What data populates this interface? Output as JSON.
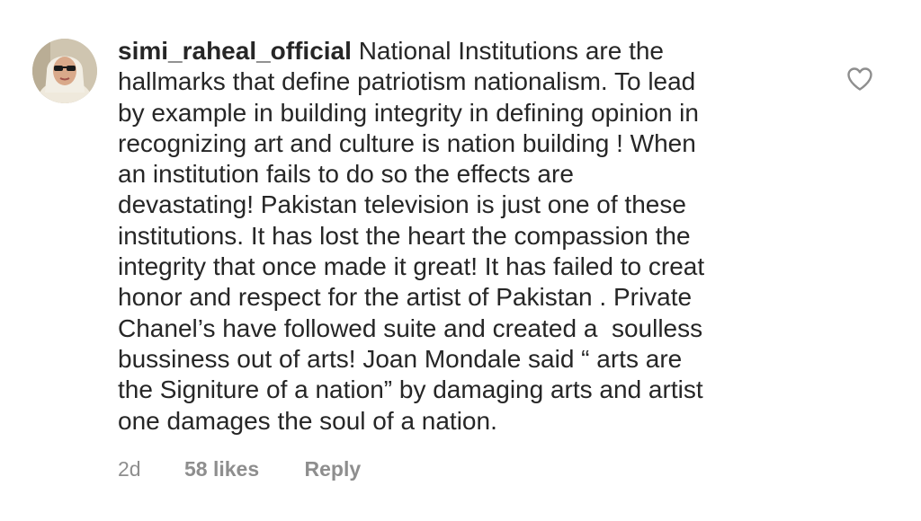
{
  "comment": {
    "username": "simi_raheal_official",
    "lines": [
      "National Institutions are the",
      "hallmarks that define patriotism nationalism. To lead",
      "by example in building integrity in defining opinion in",
      "recognizing art and culture is nation building ! When",
      "an institution fails to do so the effects are",
      "devastating! Pakistan television is just one of these",
      "institutions. It has lost the heart the compassion the",
      "integrity that once made it great! It has failed to creat",
      "honor and respect for the artist of Pakistan . Private",
      "Chanel’s have followed suite and created a  soulless",
      "bussiness out of arts! Joan Mondale said “ arts are",
      "the Signiture of a nation” by damaging arts and artist",
      "one damages the soul of a nation."
    ]
  },
  "meta": {
    "time": "2d",
    "likes": "58 likes",
    "reply_label": "Reply"
  },
  "icons": {
    "like": "heart-outline-icon",
    "avatar": "profile-avatar"
  },
  "colors": {
    "text": "#262626",
    "secondary_text": "#8e8e8e",
    "icon_stroke": "#8e8e8e"
  }
}
